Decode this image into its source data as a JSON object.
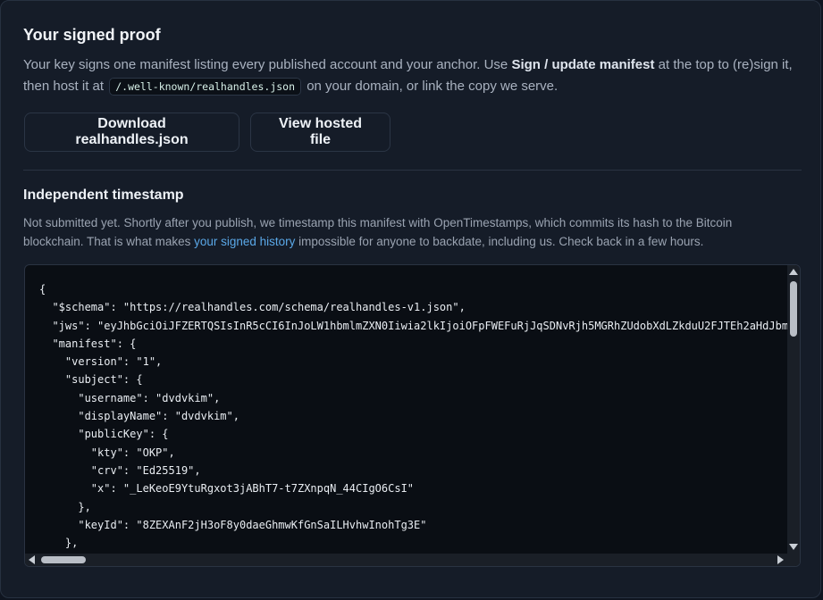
{
  "signed_proof": {
    "title": "Your signed proof",
    "desc_part1": "Your key signs one manifest listing every published account and your anchor. Use ",
    "desc_bold": "Sign / update manifest",
    "desc_part2": " at the top to (re)sign it, then host it at ",
    "desc_code": "/.well-known/realhandles.json",
    "desc_part3": " on your domain, or link the copy we serve.",
    "download_button": "Download realhandles.json",
    "view_button": "View hosted file"
  },
  "timestamp": {
    "title": "Independent timestamp",
    "desc_part1": "Not submitted yet. Shortly after you publish, we timestamp this manifest with OpenTimestamps, which commits its hash to the Bitcoin blockchain. That is what makes ",
    "desc_link": "your signed history",
    "desc_part2": " impossible for anyone to backdate, including us. Check back in a few hours."
  },
  "code_lines": [
    "{",
    "  \"$schema\": \"https://realhandles.com/schema/realhandles-v1.json\",",
    "  \"jws\": \"eyJhbGciOiJFZERTQSIsInR5cCI6InJoLW1hbmlmZXN0Iiwia2lkIjoiOFpFWEFuRjJqSDNvRjh5MGRhZUdobXdLZkduU2FJTEh2aHdJbm",
    "  \"manifest\": {",
    "    \"version\": \"1\",",
    "    \"subject\": {",
    "      \"username\": \"dvdvkim\",",
    "      \"displayName\": \"dvdvkim\",",
    "      \"publicKey\": {",
    "        \"kty\": \"OKP\",",
    "        \"crv\": \"Ed25519\",",
    "        \"x\": \"_LeKeoE9YtuRgxot3jABhT7-t7ZXnpqN_44CIgO6CsI\"",
    "      },",
    "      \"keyId\": \"8ZEXAnF2jH3oF8y0daeGhmwKfGnSaILHvhwInohTg3E\"",
    "    },"
  ]
}
